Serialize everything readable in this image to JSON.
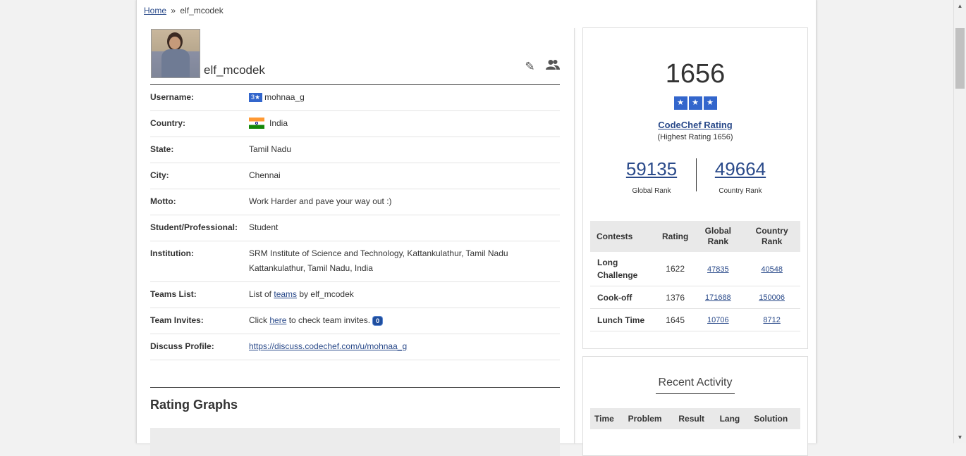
{
  "breadcrumb": {
    "home": "Home",
    "separator": "»",
    "current": "elf_mcodek"
  },
  "profile": {
    "name": "elf_mcodek",
    "edit_icon": "pencil-icon",
    "friends_icon": "users-icon",
    "fields": {
      "username_label": "Username:",
      "username_badge": "3★",
      "username": "mohnaa_g",
      "country_label": "Country:",
      "country": "India",
      "state_label": "State:",
      "state": "Tamil Nadu",
      "city_label": "City:",
      "city": "Chennai",
      "motto_label": "Motto:",
      "motto": "Work Harder and pave your way out :)",
      "student_label": "Student/Professional:",
      "student": "Student",
      "institution_label": "Institution:",
      "institution_line1": "SRM Institute of Science and Technology, Kattankulathur, Tamil Nadu",
      "institution_line2": "Kattankulathur, Tamil Nadu, India",
      "teams_label": "Teams List:",
      "teams_pre": "List of ",
      "teams_link": "teams",
      "teams_post": " by elf_mcodek",
      "invites_label": "Team Invites:",
      "invites_pre": "Click ",
      "invites_link": "here",
      "invites_post": " to check team invites.",
      "invites_count": "0",
      "discuss_label": "Discuss Profile:",
      "discuss_link": "https://discuss.codechef.com/u/mohnaa_g"
    },
    "rating_graphs_title": "Rating Graphs"
  },
  "rating_card": {
    "rating": "1656",
    "star_glyph": "★",
    "title": "CodeChef Rating",
    "highest": "(Highest Rating 1656)",
    "global_rank": "59135",
    "global_rank_label": "Global Rank",
    "country_rank": "49664",
    "country_rank_label": "Country Rank",
    "table_headers": {
      "contests": "Contests",
      "rating": "Rating",
      "global": "Global Rank",
      "country": "Country Rank"
    },
    "rows": [
      {
        "contest": "Long Challenge",
        "rating": "1622",
        "global": "47835",
        "country": "40548"
      },
      {
        "contest": "Cook-off",
        "rating": "1376",
        "global": "171688",
        "country": "150006"
      },
      {
        "contest": "Lunch Time",
        "rating": "1645",
        "global": "10706",
        "country": "8712"
      }
    ]
  },
  "recent_activity": {
    "title": "Recent Activity",
    "headers": {
      "time": "Time",
      "problem": "Problem",
      "result": "Result",
      "lang": "Lang",
      "solution": "Solution"
    }
  },
  "colors": {
    "accent": "#3366cc",
    "link": "#2a4a8a"
  }
}
